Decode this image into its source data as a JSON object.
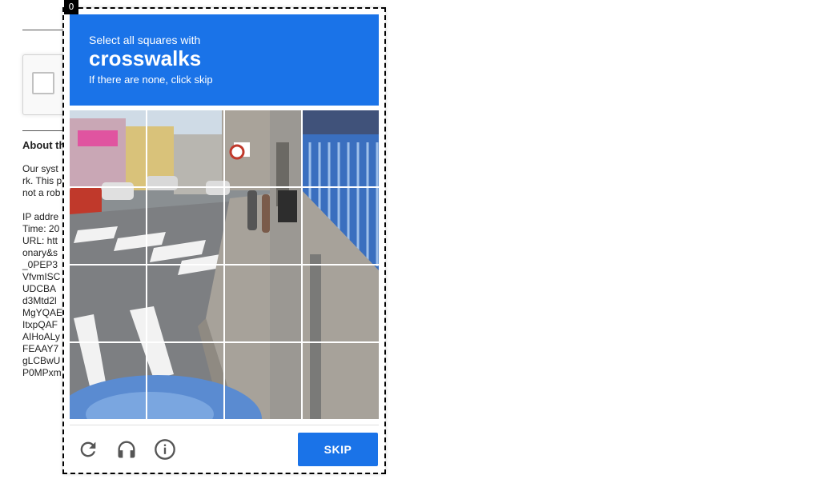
{
  "background_page": {
    "about_heading": "About th",
    "body_lines": [
      "Our syst",
      "rk. This p",
      "not a rob",
      "",
      "IP addre",
      "Time: 20",
      "URL: htt",
      "onary&s",
      "_0PEP3",
      "VfvmISC",
      "UDCBA",
      "d3Mtd2l",
      "MgYQAE",
      "ItxpQAF",
      "AIHoALy",
      "FEAAY7",
      "gLCBwU",
      "P0MPxm"
    ]
  },
  "popup": {
    "index_badge": "0",
    "header": {
      "instruction": "Select all squares with",
      "target": "crosswalks",
      "hint": "If there are none, click skip"
    },
    "grid": {
      "rows": 4,
      "cols": 4
    },
    "footer": {
      "reload_icon": "reload-icon",
      "audio_icon": "headphones-icon",
      "info_icon": "info-icon",
      "skip_label": "SKIP"
    },
    "colors": {
      "header_bg": "#1a73e8",
      "skip_bg": "#1a73e8",
      "icon": "#555555"
    }
  }
}
